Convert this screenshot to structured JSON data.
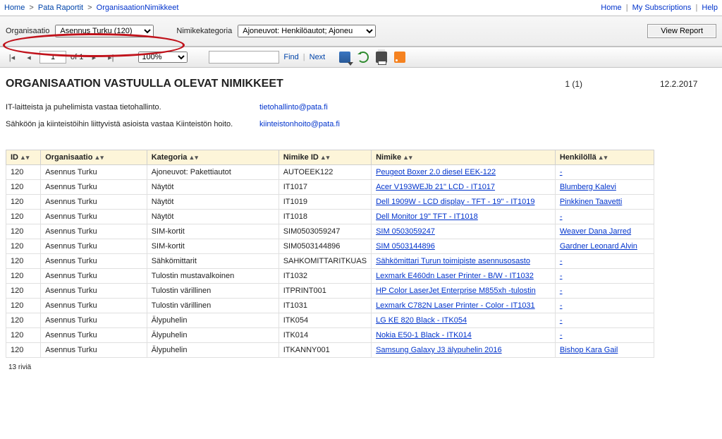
{
  "breadcrumb": {
    "home": "Home",
    "mid": "Pata Raportit",
    "last": "OrganisaationNimikkeet"
  },
  "topnav": {
    "home": "Home",
    "subs": "My Subscriptions",
    "help": "Help"
  },
  "params": {
    "org_label": "Organisaatio",
    "org_value": "Asennus Turku (120)",
    "cat_label": "Nimikekategoria",
    "cat_value": "Ajoneuvot: Henkilöautot; Ajoneu",
    "view_btn": "View Report"
  },
  "toolbar": {
    "page": "1",
    "of": "of 1",
    "zoom": "100%",
    "find": "Find",
    "next": "Next",
    "search_placeholder": ""
  },
  "report": {
    "title": "ORGANISAATION VASTUULLA OLEVAT NIMIKKEET",
    "page": "1 (1)",
    "date": "12.2.2017",
    "contact1_lbl": "IT-laitteista ja puhelimista vastaa tietohallinto.",
    "contact1_val": "tietohallinto@pata.fi",
    "contact2_lbl": "Sähköön ja kiinteistöihin liittyvistä asioista vastaa Kiinteistön hoito.",
    "contact2_val": "kiinteistonhoito@pata.fi"
  },
  "columns": {
    "c0": "ID",
    "c1": "Organisaatio",
    "c2": "Kategoria",
    "c3": "Nimike ID",
    "c4": "Nimike",
    "c5": "Henkilöllä"
  },
  "rows": [
    {
      "id": "120",
      "org": "Asennus Turku",
      "cat": "Ajoneuvot: Pakettiautot",
      "nid": "AUTOEEK122",
      "nim": "Peugeot Boxer 2.0 diesel EEK-122",
      "hen": "-"
    },
    {
      "id": "120",
      "org": "Asennus Turku",
      "cat": "Näytöt",
      "nid": "IT1017",
      "nim": "Acer V193WEJb 21\" LCD - IT1017",
      "hen": "Blumberg Kalevi"
    },
    {
      "id": "120",
      "org": "Asennus Turku",
      "cat": "Näytöt",
      "nid": "IT1019",
      "nim": "Dell 1909W - LCD display - TFT - 19\" - IT1019",
      "hen": "Pinkkinen Taavetti"
    },
    {
      "id": "120",
      "org": "Asennus Turku",
      "cat": "Näytöt",
      "nid": "IT1018",
      "nim": "Dell Monitor 19\" TFT - IT1018",
      "hen": "-"
    },
    {
      "id": "120",
      "org": "Asennus Turku",
      "cat": "SIM-kortit",
      "nid": "SIM0503059247",
      "nim": "SIM 0503059247",
      "hen": "Weaver Dana Jarred"
    },
    {
      "id": "120",
      "org": "Asennus Turku",
      "cat": "SIM-kortit",
      "nid": "SIM0503144896",
      "nim": "SIM 0503144896",
      "hen": "Gardner Leonard Alvin"
    },
    {
      "id": "120",
      "org": "Asennus Turku",
      "cat": "Sähkömittarit",
      "nid": "SAHKOMITTARITKUAS",
      "nim": "Sähkömittari Turun toimipiste asennusosasto",
      "hen": "-"
    },
    {
      "id": "120",
      "org": "Asennus Turku",
      "cat": "Tulostin mustavalkoinen",
      "nid": "IT1032",
      "nim": "Lexmark E460dn Laser Printer - B/W - IT1032",
      "hen": "-"
    },
    {
      "id": "120",
      "org": "Asennus Turku",
      "cat": "Tulostin värillinen",
      "nid": "ITPRINT001",
      "nim": "HP Color LaserJet Enterprise M855xh -tulostin",
      "hen": "-"
    },
    {
      "id": "120",
      "org": "Asennus Turku",
      "cat": "Tulostin värillinen",
      "nid": "IT1031",
      "nim": "Lexmark C782N Laser Printer - Color - IT1031",
      "hen": "-"
    },
    {
      "id": "120",
      "org": "Asennus Turku",
      "cat": "Älypuhelin",
      "nid": "ITK054",
      "nim": "LG KE 820 Black - ITK054",
      "hen": "-"
    },
    {
      "id": "120",
      "org": "Asennus Turku",
      "cat": "Älypuhelin",
      "nid": "ITK014",
      "nim": "Nokia E50-1 Black - ITK014",
      "hen": "-"
    },
    {
      "id": "120",
      "org": "Asennus Turku",
      "cat": "Älypuhelin",
      "nid": "ITKANNY001",
      "nim": "Samsung Galaxy J3 älypuhelin 2016",
      "hen": "Bishop Kara Gail"
    }
  ],
  "rowcount": "13 riviä"
}
